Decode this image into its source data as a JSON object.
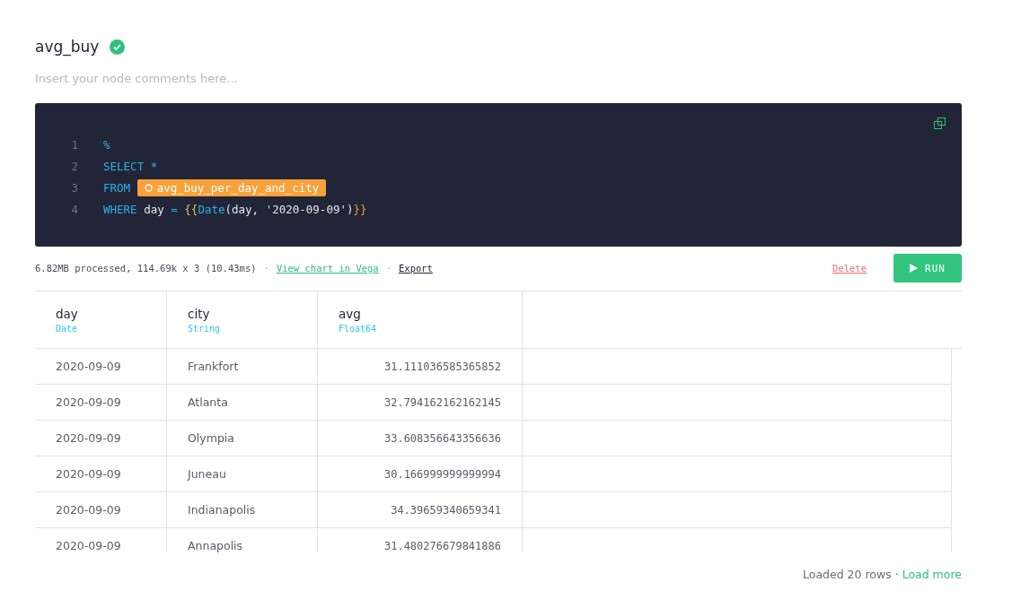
{
  "node": {
    "title": "avg_buy",
    "verified": true,
    "comment_placeholder": "Insert your node comments here..."
  },
  "editor": {
    "lines": [
      {
        "number": "1",
        "tokens": [
          {
            "kind": "keyword",
            "text": "%"
          }
        ]
      },
      {
        "number": "2",
        "tokens": [
          {
            "kind": "keyword",
            "text": "SELECT *"
          }
        ]
      },
      {
        "number": "3",
        "tokens": [
          {
            "kind": "keyword",
            "text": "FROM"
          },
          {
            "kind": "node-ref",
            "text": "avg_buy_per_day_and_city"
          }
        ]
      },
      {
        "number": "4",
        "tokens": [
          {
            "kind": "keyword",
            "text": "WHERE"
          },
          {
            "kind": "plain",
            "text": " day "
          },
          {
            "kind": "operator",
            "text": "="
          },
          {
            "kind": "brace-open",
            "text": "{{"
          },
          {
            "kind": "function",
            "text": "Date"
          },
          {
            "kind": "plain",
            "text": "(day, '2020-09-09')"
          },
          {
            "kind": "brace-close",
            "text": "}}"
          }
        ]
      }
    ]
  },
  "stats": {
    "text": "6.82MB processed, 114.69k x 3 (10.43ms)",
    "separator": "·",
    "links": [
      "View chart in Vega",
      "Export"
    ]
  },
  "actions": {
    "delete": "Delete",
    "run": "RUN"
  },
  "table": {
    "columns": [
      {
        "name": "day",
        "type": "Date"
      },
      {
        "name": "city",
        "type": "String"
      },
      {
        "name": "avg",
        "type": "Float64"
      }
    ],
    "rows": [
      [
        "2020-09-09",
        "Frankfort",
        "31.111036585365852"
      ],
      [
        "2020-09-09",
        "Atlanta",
        "32.794162162162145"
      ],
      [
        "2020-09-09",
        "Olympia",
        "33.608356643356636"
      ],
      [
        "2020-09-09",
        "Juneau",
        "30.166999999999994"
      ],
      [
        "2020-09-09",
        "Indianapolis",
        "34.39659340659341"
      ],
      [
        "2020-09-09",
        "Annapolis",
        "31.480276679841886"
      ]
    ]
  },
  "footer": {
    "text": "Loaded 20 rows ·",
    "link": "Load more"
  }
}
